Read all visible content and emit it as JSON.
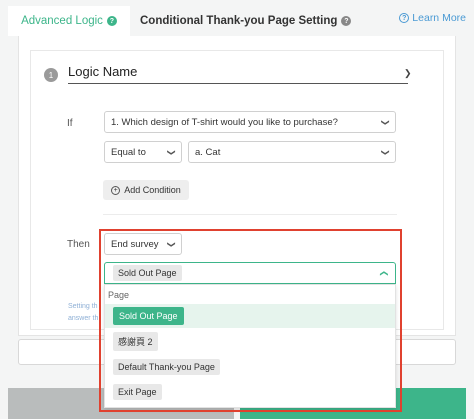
{
  "tabs": {
    "active_label": "Advanced Logic",
    "second_label": "Conditional Thank-you Page Setting",
    "learn_more": "Learn More"
  },
  "logic": {
    "step_number": "1",
    "name": "Logic Name",
    "if_label": "If",
    "question_select": "1. Which design of T-shirt would you like to purchase?",
    "operator_select": "Equal to",
    "value_select": "a. Cat",
    "add_condition": "Add Condition",
    "then_label": "Then",
    "action_select": "End survey",
    "hint_line1": "Setting th",
    "hint_line2": "answer th"
  },
  "dropdown": {
    "selected": "Sold Out Page",
    "group_label": "Page",
    "options": [
      "Sold Out Page",
      "感謝頁 2",
      "Default Thank-you Page",
      "Exit Page"
    ]
  },
  "colors": {
    "accent": "#3db58a",
    "link": "#4a9ad4",
    "highlight": "#e0412f"
  },
  "icons": {
    "help": "question-circle-icon",
    "expand": "chevron-down-icon",
    "collapse": "chevron-up-icon",
    "add": "plus-circle-icon"
  }
}
